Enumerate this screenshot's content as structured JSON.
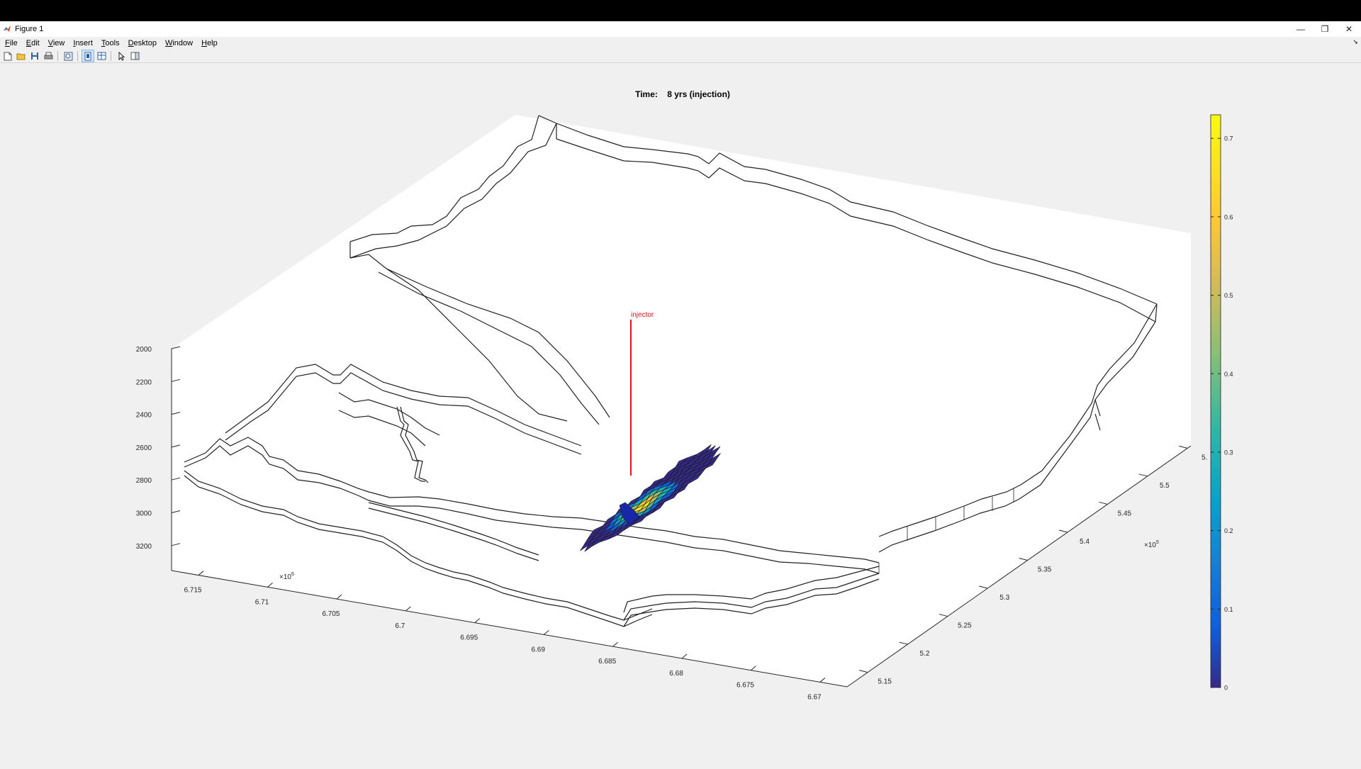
{
  "window": {
    "title": "Figure 1",
    "minimize": "—",
    "restore": "❐",
    "close": "✕"
  },
  "menu": {
    "items": [
      {
        "u": "F",
        "rest": "ile"
      },
      {
        "u": "E",
        "rest": "dit"
      },
      {
        "u": "V",
        "rest": "iew"
      },
      {
        "u": "I",
        "rest": "nsert"
      },
      {
        "u": "T",
        "rest": "ools"
      },
      {
        "u": "D",
        "rest": "esktop"
      },
      {
        "u": "W",
        "rest": "indow"
      },
      {
        "u": "H",
        "rest": "elp"
      }
    ],
    "arrow": "➘"
  },
  "toolbar": {
    "buttons": [
      "new-figure-icon",
      "open-file-icon",
      "save-icon",
      "print-icon",
      "zoom-icon",
      "data-cursor-icon",
      "colorbar-icon",
      "pointer-icon",
      "property-inspector-icon"
    ]
  },
  "plot": {
    "title": "Time:    8 yrs (injection)",
    "well_label": "injector",
    "well_color": "#e0151e",
    "z_ticks": [
      "2000",
      "2200",
      "2400",
      "2600",
      "2800",
      "3000",
      "3200"
    ],
    "x_ticks": [
      "6.715",
      "6.71",
      "6.705",
      "6.7",
      "6.695",
      "6.69",
      "6.685",
      "6.68",
      "6.675",
      "6.67"
    ],
    "x_exponent_base": "×10",
    "x_exponent": "6",
    "y_ticks": [
      "5.15",
      "5.2",
      "5.25",
      "5.3",
      "5.35",
      "5.4",
      "5.45",
      "5.5",
      "5."
    ],
    "y_exponent_base": "×10",
    "y_exponent": "5",
    "colorbar_ticks": [
      "0",
      "0.1",
      "0.2",
      "0.3",
      "0.4",
      "0.5",
      "0.6",
      "0.7"
    ],
    "colormap": "parula"
  }
}
